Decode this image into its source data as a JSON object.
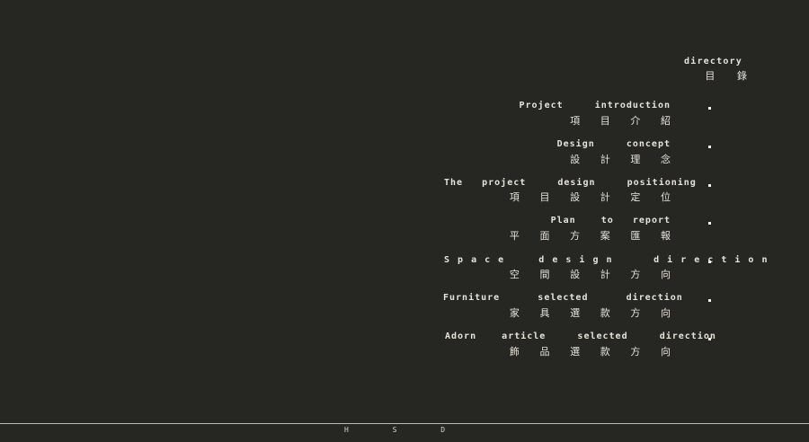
{
  "directory": {
    "en": "directory",
    "zh": "目 錄"
  },
  "items": [
    {
      "en": "Project     introduction",
      "zh": "項 目 介 紹"
    },
    {
      "en": "Design     concept",
      "zh": "設 計 理 念"
    },
    {
      "en": "The   project     design     positioning",
      "zh": "項 目 設 計 定 位"
    },
    {
      "en": "Plan    to   report",
      "zh": "平 面 方 案 匯 報"
    },
    {
      "en": "S p a c e     d e s i g n      d i r e c t i o n",
      "zh": "空 間 設 計 方 向"
    },
    {
      "en": "Furniture      selected      direction",
      "zh": "家 具 選 款 方 向"
    },
    {
      "en": "Adorn    article     selected     direction",
      "zh": "飾 品 選 款 方 向"
    }
  ],
  "footer": {
    "text": "H S D"
  }
}
